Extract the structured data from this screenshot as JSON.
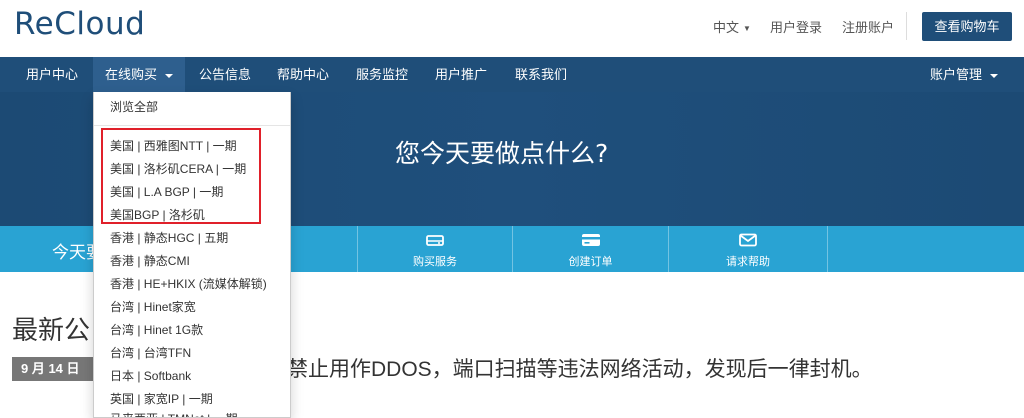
{
  "header": {
    "logo": "ReCloud",
    "language": "中文",
    "login": "用户登录",
    "register": "注册账户",
    "cart": "查看购物车"
  },
  "nav": {
    "items": [
      "用户中心",
      "在线购买",
      "公告信息",
      "帮助中心",
      "服务监控",
      "用户推广",
      "联系我们"
    ],
    "account": "账户管理",
    "active_index": 1
  },
  "hero": {
    "title": "您今天要做点什么?"
  },
  "actions": {
    "today": "今天要",
    "items": [
      {
        "label": "购买服务",
        "icon": "server-icon"
      },
      {
        "label": "创建订单",
        "icon": "credit-card-icon"
      },
      {
        "label": "请求帮助",
        "icon": "envelope-icon"
      }
    ]
  },
  "dropdown": {
    "browse_all": "浏览全部",
    "items": [
      "美国 | 西雅图NTT | 一期",
      "美国 | 洛杉矶CERA | 一期",
      "美国 | L.A BGP | 一期",
      "美国BGP | 洛杉矶",
      "香港 | 静态HGC | 五期",
      "香港 | 静态CMI",
      "香港 | HE+HKIX (流媒体解锁)",
      "台湾 | Hinet家宽",
      "台湾 | Hinet 1G款",
      "台湾 | 台湾TFN",
      "日本 | Softbank",
      "英国 | 家宽IP | 一期",
      "马来西亚 | TMNet | 一期"
    ],
    "highlight_color": "#e0202a"
  },
  "news": {
    "heading": "最新公",
    "date": "9 月 14 日",
    "text": "禁止用作DDOS，端口扫描等违法网络活动，发现后一律封机。"
  },
  "colors": {
    "brand": "#1f4e79",
    "accent": "#29a3d3"
  }
}
